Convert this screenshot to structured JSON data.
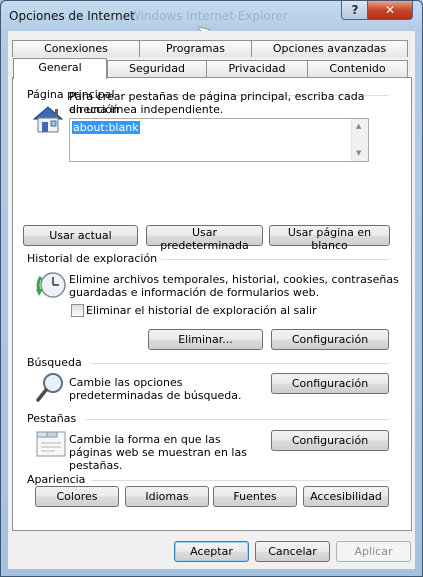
{
  "window": {
    "title": "Opciones de Internet",
    "ghost_title": "Windows Internet Explorer"
  },
  "titlebar": {
    "help_glyph": "?",
    "close_glyph": "✕"
  },
  "tabs": {
    "row1": [
      "Conexiones",
      "Programas",
      "Opciones avanzadas"
    ],
    "row2": [
      "General",
      "Seguridad",
      "Privacidad",
      "Contenido"
    ],
    "active": "General"
  },
  "home": {
    "label": "Página principal",
    "description_line1": "Para crear pestañas de página principal, escriba cada dirección",
    "description_line2": "en una línea independiente.",
    "value": "about:blank",
    "btn_current": "Usar actual",
    "btn_default": "Usar predeterminada",
    "btn_blank": "Usar página en blanco"
  },
  "history": {
    "label": "Historial de exploración",
    "description_line1": "Elimine archivos temporales, historial, cookies, contraseñas",
    "description_line2": "guardadas e información de formularios web.",
    "checkbox_label": "Eliminar el historial de exploración al salir",
    "checkbox_checked": false,
    "btn_delete": "Eliminar...",
    "btn_settings": "Configuración"
  },
  "search": {
    "label": "Búsqueda",
    "description_line1": "Cambie las opciones",
    "description_line2": "predeterminadas de búsqueda.",
    "btn_settings": "Configuración"
  },
  "tabs_section": {
    "label": "Pestañas",
    "description_line1": "Cambie la forma en que las",
    "description_line2": "páginas web se muestran en las",
    "description_line3": "pestañas.",
    "btn_settings": "Configuración"
  },
  "appearance": {
    "label": "Apariencia",
    "btn_colors": "Colores",
    "btn_languages": "Idiomas",
    "btn_fonts": "Fuentes",
    "btn_accessibility": "Accesibilidad"
  },
  "footer": {
    "ok": "Aceptar",
    "cancel": "Cancelar",
    "apply": "Aplicar"
  },
  "colors": {
    "selection": "#3399ff",
    "close_button": "#c7452b",
    "default_button_border": "#3c7fb1"
  }
}
